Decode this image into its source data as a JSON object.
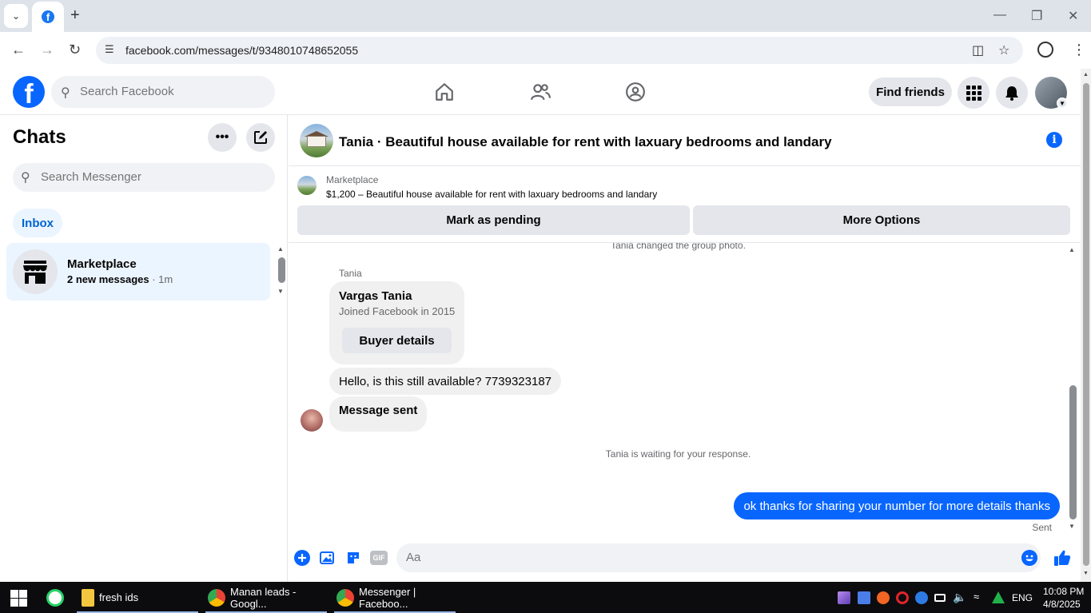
{
  "browser": {
    "url": "facebook.com/messages/t/9348010748652055",
    "min": "—",
    "restore": "❐",
    "close": "✕"
  },
  "fb_header": {
    "search_placeholder": "Search Facebook",
    "find_friends": "Find friends"
  },
  "left": {
    "title": "Chats",
    "search_placeholder": "Search Messenger",
    "inbox": "Inbox",
    "chat": {
      "name": "Marketplace",
      "preview": "2 new messages",
      "time": " · 1m"
    }
  },
  "conversation": {
    "title": "Tania · Beautiful house available for rent with laxuary bedrooms and landary",
    "listing": {
      "label": "Marketplace",
      "price_line": "$1,200 – Beautiful house available for rent with laxuary bedrooms and landary",
      "pending_button": "Mark as pending",
      "options_button": "More Options"
    },
    "messages": {
      "system_top": "Tania changed the group photo.",
      "sender": "Tania",
      "card_name": "Vargas Tania",
      "card_sub": "Joined Facebook in 2015",
      "card_button": "Buyer details",
      "incoming_1": "Hello, is this still available? 7739323187",
      "incoming_2": "Message sent",
      "system_waiting": "Tania is waiting for your response.",
      "outgoing": "ok thanks for sharing your number for more details thanks",
      "status": "Sent"
    },
    "composer": {
      "placeholder": "Aa",
      "gif": "GIF"
    }
  },
  "taskbar": {
    "apps": [
      {
        "label": "fresh ids"
      },
      {
        "label": "Manan leads - Googl..."
      },
      {
        "label": "Messenger | Faceboo..."
      }
    ],
    "lang": "ENG",
    "time": "10:08 PM",
    "date": "4/8/2025"
  },
  "colors": {
    "fb_blue": "#0866ff",
    "selected_bg": "#ebf5ff",
    "taskbar": "#0c0c0f"
  }
}
